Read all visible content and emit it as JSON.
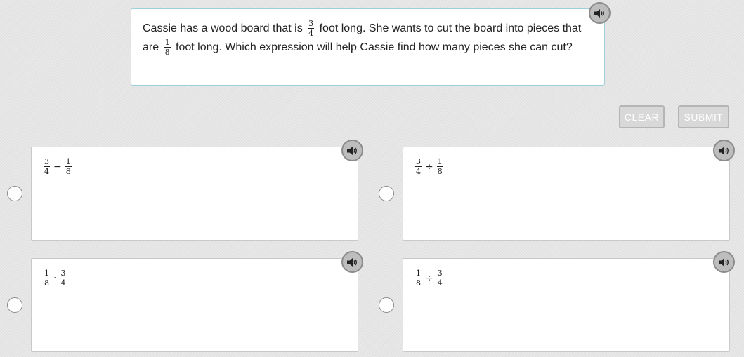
{
  "question": {
    "text_1": "Cassie has a wood board that is",
    "frac1_num": "3",
    "frac1_den": "4",
    "text_2": "foot long. She wants to cut the board into pieces that are",
    "frac2_num": "1",
    "frac2_den": "8",
    "text_3": "foot long. Which expression will help Cassie find how many pieces she can cut?"
  },
  "buttons": {
    "clear": "CLEAR",
    "submit": "SUBMIT"
  },
  "options": [
    {
      "a_num": "3",
      "a_den": "4",
      "op": "−",
      "b_num": "1",
      "b_den": "8"
    },
    {
      "a_num": "3",
      "a_den": "4",
      "op": "÷",
      "b_num": "1",
      "b_den": "8"
    },
    {
      "a_num": "1",
      "a_den": "8",
      "op": "·",
      "b_num": "3",
      "b_den": "4"
    },
    {
      "a_num": "1",
      "a_den": "8",
      "op": "÷",
      "b_num": "3",
      "b_den": "4"
    }
  ],
  "icons": {
    "audio": "speaker-icon"
  },
  "colors": {
    "question_border": "#9fd1dc",
    "button_bg": "#d8d8d8",
    "speaker_bg": "#bdbdbd"
  }
}
